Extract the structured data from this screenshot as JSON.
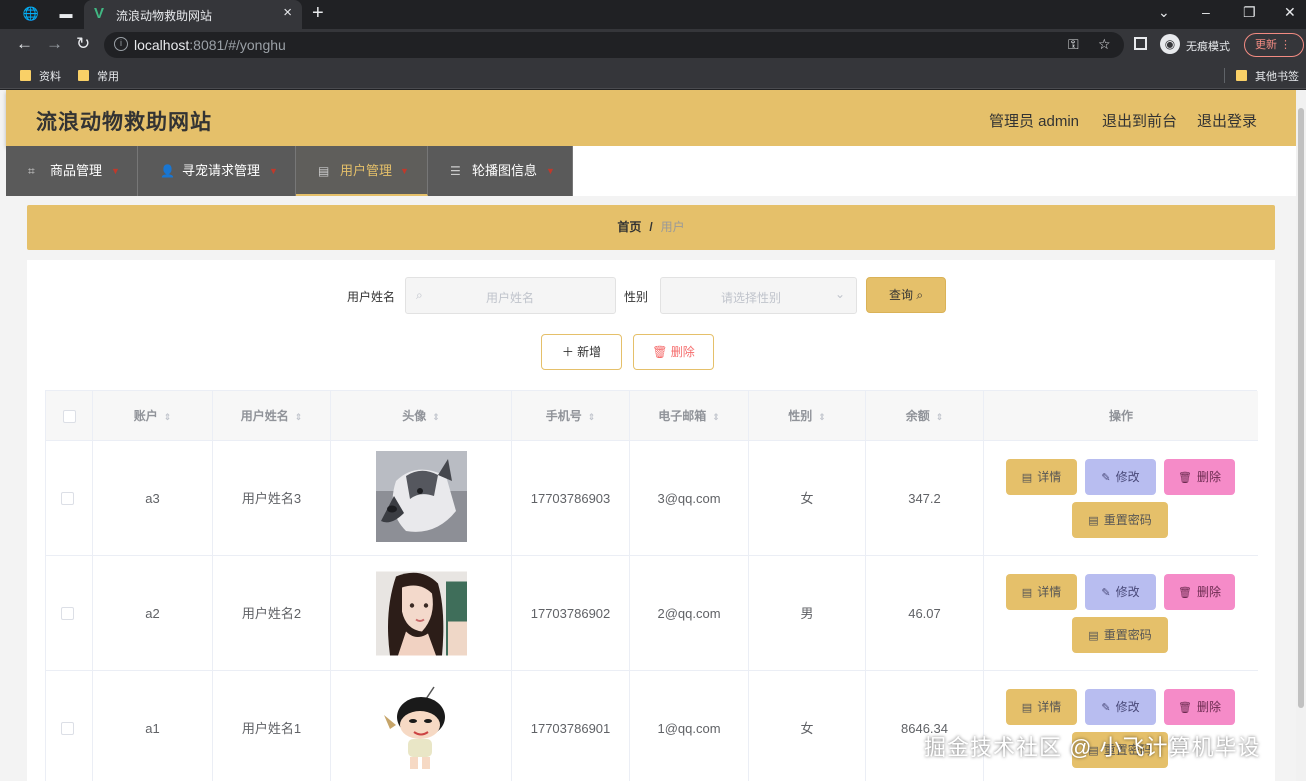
{
  "browser": {
    "tab_title": "流浪动物救助网站",
    "url_host": "localhost",
    "url_rest": ":8081/#/yonghu",
    "incognito_label": "无痕模式",
    "update_label": "更新",
    "bookmarks": [
      "资料",
      "常用"
    ],
    "other_bookmarks": "其他书签"
  },
  "site": {
    "title": "流浪动物救助网站",
    "admin_label": "管理员 admin",
    "to_front": "退出到前台",
    "logout": "退出登录"
  },
  "menu": [
    {
      "label": "商品管理",
      "icon": "crop-icon"
    },
    {
      "label": "寻宠请求管理",
      "icon": "user-icon"
    },
    {
      "label": "用户管理",
      "icon": "chart-icon",
      "active": true
    },
    {
      "label": "轮播图信息",
      "icon": "list-icon"
    }
  ],
  "breadcrumb": {
    "home": "首页",
    "separator": "/",
    "current": "用户"
  },
  "search": {
    "name_label": "用户姓名",
    "name_placeholder": "用户姓名",
    "gender_label": "性别",
    "gender_placeholder": "请选择性别",
    "query_label": "查询"
  },
  "actions": {
    "add_label": "新增",
    "delete_label": "删除"
  },
  "table": {
    "columns": [
      "账户",
      "用户姓名",
      "头像",
      "手机号",
      "电子邮箱",
      "性别",
      "余额",
      "操作"
    ],
    "rows": [
      {
        "account": "a3",
        "name": "用户姓名3",
        "phone": "17703786903",
        "email": "3@qq.com",
        "gender": "女",
        "balance": "347.2"
      },
      {
        "account": "a2",
        "name": "用户姓名2",
        "phone": "17703786902",
        "email": "2@qq.com",
        "gender": "男",
        "balance": "46.07"
      },
      {
        "account": "a1",
        "name": "用户姓名1",
        "phone": "17703786901",
        "email": "1@qq.com",
        "gender": "女",
        "balance": "8646.34"
      }
    ],
    "op_labels": {
      "detail": "详情",
      "edit": "修改",
      "remove": "删除",
      "reset": "重置密码"
    }
  },
  "watermark": "掘金技术社区 @ 小飞计算机毕设",
  "colors": {
    "accent": "#e5c06a",
    "menu_bg": "#5a5a5a",
    "edit_btn": "#b8bdf0",
    "remove_btn": "#f58bc8"
  }
}
